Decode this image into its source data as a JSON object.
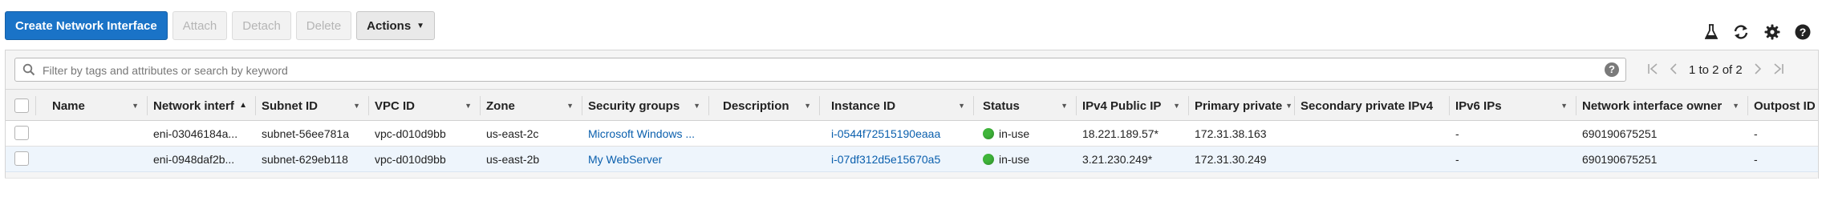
{
  "toolbar": {
    "create_label": "Create Network Interface",
    "attach_label": "Attach",
    "detach_label": "Detach",
    "delete_label": "Delete",
    "actions_label": "Actions"
  },
  "top_icons": [
    "flask-icon",
    "refresh-icon",
    "gear-icon",
    "help-icon"
  ],
  "filter": {
    "placeholder": "Filter by tags and attributes or search by keyword",
    "help": "?"
  },
  "pager": {
    "text": "1 to 2 of 2"
  },
  "columns": [
    "Name",
    "Network interf",
    "Subnet ID",
    "VPC ID",
    "Zone",
    "Security groups",
    "Description",
    "Instance ID",
    "Status",
    "IPv4 Public IP",
    "Primary private",
    "Secondary private IPv4",
    "IPv6 IPs",
    "Network interface owner",
    "Outpost ID"
  ],
  "rows": [
    {
      "name": "",
      "eni": "eni-03046184a...",
      "subnet": "subnet-56ee781a",
      "vpc": "vpc-d010d9bb",
      "zone": "us-east-2c",
      "sg": "Microsoft Windows ...",
      "description": "",
      "instance": "i-0544f72515190eaaa",
      "status": "in-use",
      "public_ip": "18.221.189.57*",
      "private_ip": "172.31.38.163",
      "secondary": "",
      "ipv6": "-",
      "owner": "690190675251",
      "outpost": "-"
    },
    {
      "name": "",
      "eni": "eni-0948daf2b...",
      "subnet": "subnet-629eb118",
      "vpc": "vpc-d010d9bb",
      "zone": "us-east-2b",
      "sg": "My WebServer",
      "description": "",
      "instance": "i-07df312d5e15670a5",
      "status": "in-use",
      "public_ip": "3.21.230.249*",
      "private_ip": "172.31.30.249",
      "secondary": "",
      "ipv6": "-",
      "owner": "690190675251",
      "outpost": "-"
    }
  ],
  "colors": {
    "primary": "#1a73c7",
    "link": "#0a5fad",
    "status_ok": "#3fb53a",
    "selected_row": "#eef5fc"
  }
}
